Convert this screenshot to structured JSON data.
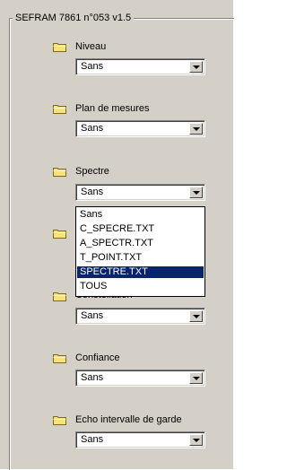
{
  "panel": {
    "title": "SEFRAM 7861 n°053 v1.5"
  },
  "groups": [
    {
      "label": "Niveau",
      "value": "Sans",
      "icon": "folder-icon"
    },
    {
      "label": "Plan de mesures",
      "value": "Sans",
      "icon": "folder-icon"
    },
    {
      "label": "Spectre",
      "value": "Sans",
      "icon": "folder-icon"
    },
    {
      "label": "",
      "value": "",
      "icon": "folder-icon"
    },
    {
      "label": "Constellation",
      "value": "Sans",
      "icon": "folder-icon"
    },
    {
      "label": "Confiance",
      "value": "Sans",
      "icon": "folder-icon"
    },
    {
      "label": "Echo intervalle de garde",
      "value": "Sans",
      "icon": "folder-icon"
    }
  ],
  "dropdown": {
    "options": [
      "Sans",
      "C_SPECRE.TXT",
      "A_SPECTR.TXT",
      "T_POINT.TXT",
      "SPECTRE.TXT",
      "TOUS"
    ],
    "selected_index": 4
  },
  "colors": {
    "highlight": "#0a246a",
    "face": "#d4d0c8"
  }
}
